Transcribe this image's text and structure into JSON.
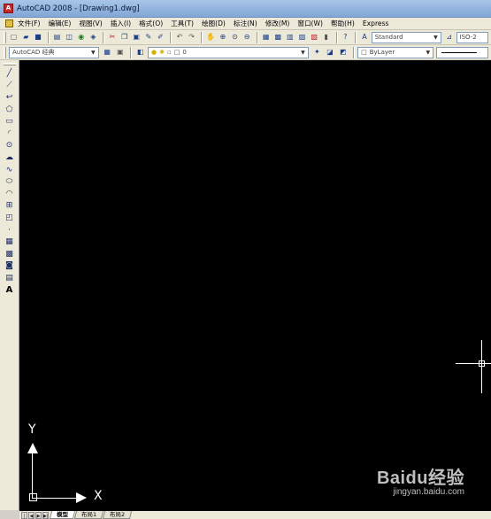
{
  "window": {
    "title": "AutoCAD 2008 - [Drawing1.dwg]"
  },
  "menu": [
    "文件(F)",
    "编辑(E)",
    "视图(V)",
    "插入(I)",
    "格式(O)",
    "工具(T)",
    "绘图(D)",
    "标注(N)",
    "修改(M)",
    "窗口(W)",
    "帮助(H)",
    "Express"
  ],
  "toolbar1": {
    "text_style": "Standard",
    "dim_style": "ISO-2"
  },
  "toolbar2": {
    "workspace": "AutoCAD 经典",
    "layer": "0",
    "color": "ByLayer"
  },
  "canvas": {
    "ucs_y": "Y",
    "ucs_x": "X",
    "watermark_main": "Baidu经验",
    "watermark_sub": "jingyan.baidu.com"
  },
  "tabs": [
    "模型",
    "布局1",
    "布局2"
  ],
  "icons": {
    "left_tools": [
      "line-icon",
      "construction-line-icon",
      "polyline-icon",
      "polygon-icon",
      "rectangle-icon",
      "arc-icon",
      "circle-icon",
      "revision-cloud-icon",
      "spline-icon",
      "ellipse-icon",
      "ellipse-arc-icon",
      "insert-block-icon",
      "make-block-icon",
      "point-icon",
      "hatch-icon",
      "gradient-icon",
      "region-icon",
      "table-icon",
      "multiline-text-icon"
    ]
  }
}
